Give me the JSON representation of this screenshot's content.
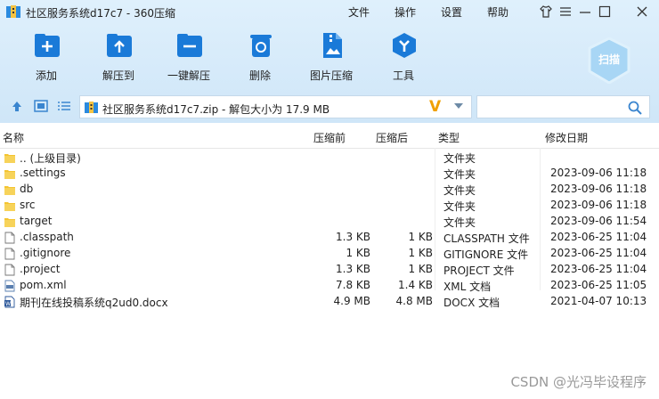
{
  "window": {
    "title": "社区服务系统d17c7 - 360压缩",
    "menus": [
      "文件",
      "操作",
      "设置",
      "帮助"
    ]
  },
  "toolbar": {
    "buttons": [
      {
        "label": "添加",
        "icon": "add-icon"
      },
      {
        "label": "解压到",
        "icon": "extract-to-icon"
      },
      {
        "label": "一键解压",
        "icon": "one-click-extract-icon"
      },
      {
        "label": "删除",
        "icon": "delete-icon"
      },
      {
        "label": "图片压缩",
        "icon": "image-compress-icon"
      },
      {
        "label": "工具",
        "icon": "tools-icon"
      }
    ],
    "scan_label": "扫描"
  },
  "path_bar": {
    "text": "社区服务系统d17c7.zip - 解包大小为 17.9 MB"
  },
  "columns": {
    "name": "名称",
    "before": "压缩前",
    "after": "压缩后",
    "type": "类型",
    "date": "修改日期"
  },
  "files": [
    {
      "name": ".. (上级目录)",
      "before": "",
      "after": "",
      "type": "文件夹",
      "date": "",
      "icon": "folder"
    },
    {
      "name": ".settings",
      "before": "",
      "after": "",
      "type": "文件夹",
      "date": "2023-09-06 11:18",
      "icon": "folder"
    },
    {
      "name": "db",
      "before": "",
      "after": "",
      "type": "文件夹",
      "date": "2023-09-06 11:18",
      "icon": "folder"
    },
    {
      "name": "src",
      "before": "",
      "after": "",
      "type": "文件夹",
      "date": "2023-09-06 11:18",
      "icon": "folder"
    },
    {
      "name": "target",
      "before": "",
      "after": "",
      "type": "文件夹",
      "date": "2023-09-06 11:54",
      "icon": "folder"
    },
    {
      "name": ".classpath",
      "before": "1.3 KB",
      "after": "1 KB",
      "type": "CLASSPATH 文件",
      "date": "2023-06-25 11:04",
      "icon": "file"
    },
    {
      "name": ".gitignore",
      "before": "1 KB",
      "after": "1 KB",
      "type": "GITIGNORE 文件",
      "date": "2023-06-25 11:04",
      "icon": "file"
    },
    {
      "name": ".project",
      "before": "1.3 KB",
      "after": "1 KB",
      "type": "PROJECT 文件",
      "date": "2023-06-25 11:04",
      "icon": "file"
    },
    {
      "name": "pom.xml",
      "before": "7.8 KB",
      "after": "1.4 KB",
      "type": "XML 文档",
      "date": "2023-06-25 11:05",
      "icon": "xml"
    },
    {
      "name": "期刊在线投稿系统q2ud0.docx",
      "before": "4.9 MB",
      "after": "4.8 MB",
      "type": "DOCX 文档",
      "date": "2021-04-07 10:13",
      "icon": "docx"
    }
  ],
  "watermark": "CSDN @光冯毕设程序"
}
